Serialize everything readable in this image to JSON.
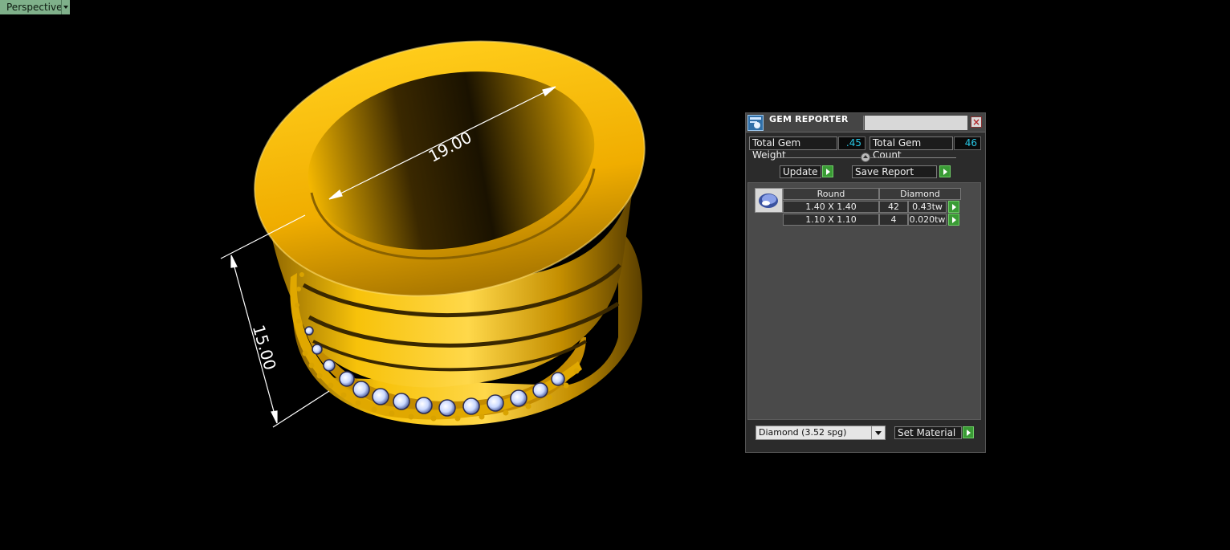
{
  "viewport": {
    "view_label": "Perspective"
  },
  "dimensions": {
    "diameter": "19.00",
    "height": "15.00"
  },
  "panel": {
    "title": "GEM REPORTER",
    "total_weight_label": "Total Gem Weight",
    "total_weight_value": ".45",
    "total_count_label": "Total Gem Count",
    "total_count_value": "46",
    "update_label": "Update",
    "save_report_label": "Save Report",
    "table": {
      "headers": [
        "Round",
        "Diamond"
      ],
      "rows": [
        {
          "size": "1.40 X 1.40",
          "count": "42",
          "weight": "0.43tw"
        },
        {
          "size": "1.10 X 1.10",
          "count": "4",
          "weight": "0.020tw"
        }
      ]
    },
    "material_value": "Diamond     (3.52 spg)",
    "set_material_label": "Set Material"
  },
  "colors": {
    "gold": "#f2b400",
    "gold_dark": "#7a5500",
    "panel_bg": "#2b2b2b",
    "go_green": "#3a9b35",
    "value_cyan": "#27c8e6"
  }
}
